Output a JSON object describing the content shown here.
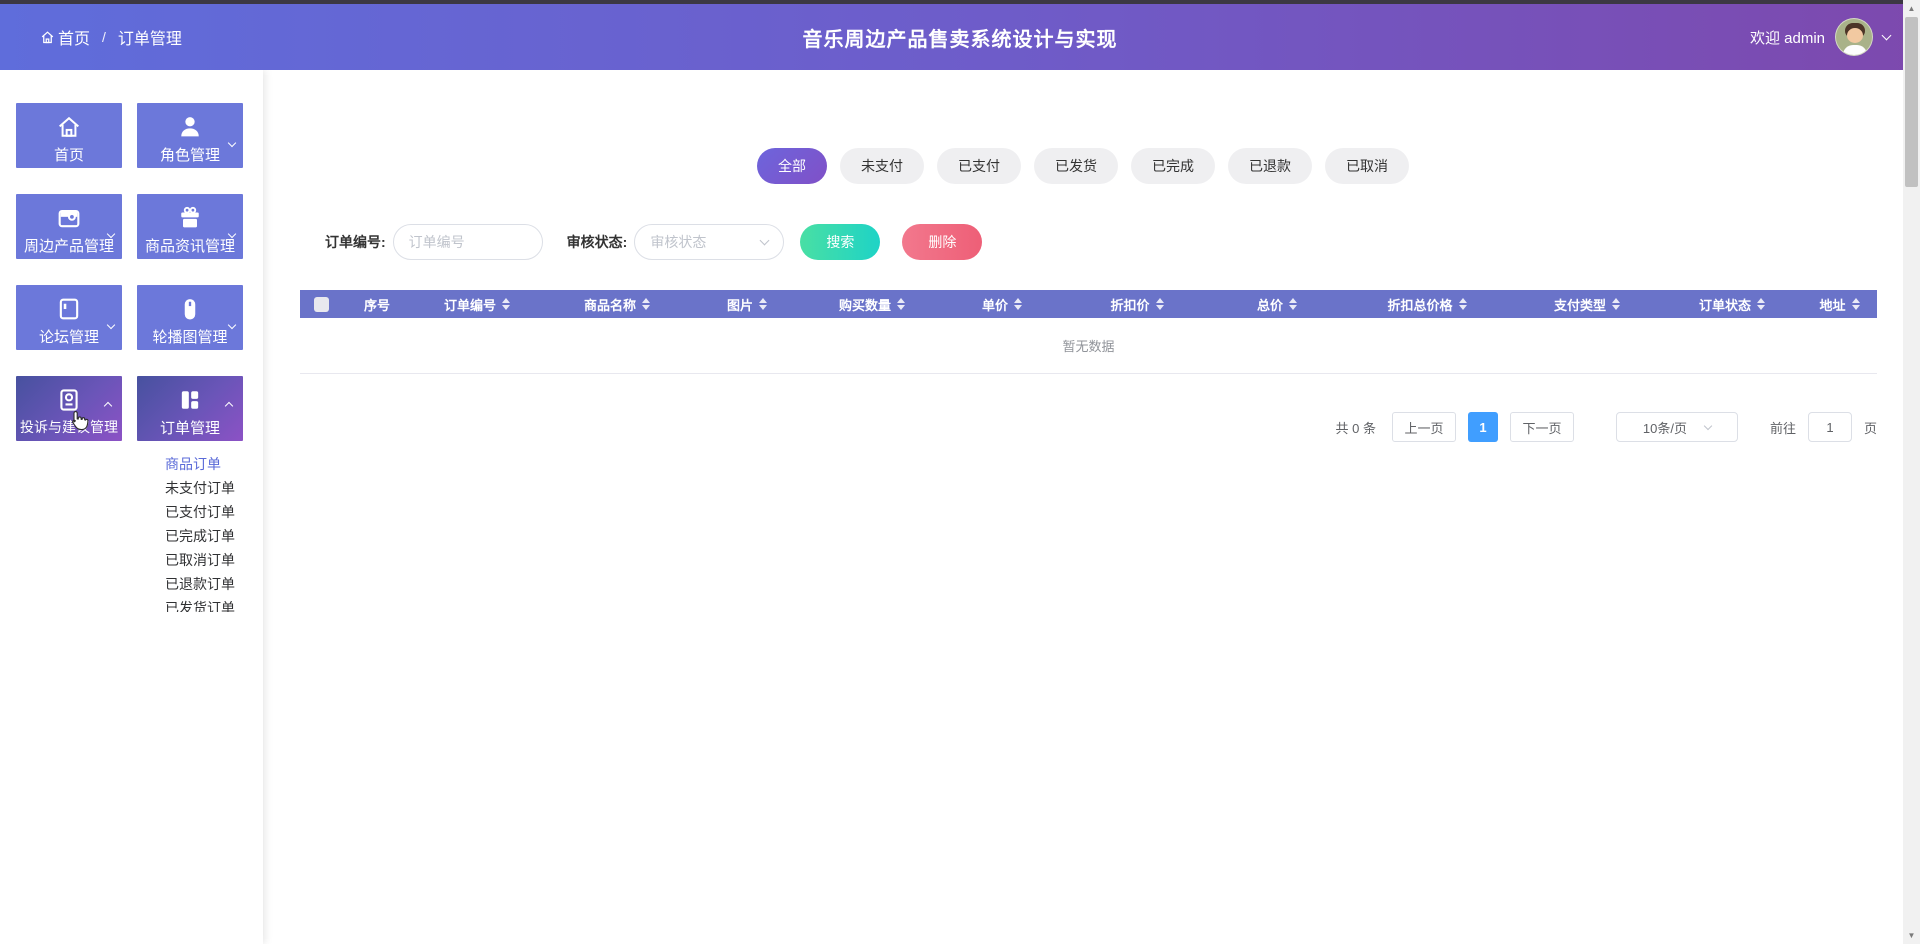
{
  "header": {
    "breadcrumb": {
      "home": "首页",
      "separator": "/",
      "current": "订单管理",
      "home_icon": "home-icon"
    },
    "title": "音乐周边产品售卖系统设计与实现",
    "welcome": "欢迎 admin",
    "avatar_icon": "user-avatar",
    "dropdown_icon": "chevron-down-icon"
  },
  "sidebar": {
    "tiles": [
      {
        "label": "首页",
        "icon": "home-icon",
        "variant": "flat",
        "chevron": false
      },
      {
        "label": "角色管理",
        "icon": "user-icon",
        "variant": "flat",
        "chevron": true
      },
      {
        "label": "周边产品管理",
        "icon": "product-box-icon",
        "variant": "flat",
        "chevron": true
      },
      {
        "label": "商品资讯管理",
        "icon": "gift-icon",
        "variant": "flat",
        "chevron": true
      },
      {
        "label": "论坛管理",
        "icon": "notebook-icon",
        "variant": "flat",
        "chevron": true
      },
      {
        "label": "轮播图管理",
        "icon": "mouse-icon",
        "variant": "flat",
        "chevron": true
      },
      {
        "label": "投诉与建议管理",
        "icon": "contact-badge-icon",
        "variant": "gradient",
        "chevron": true
      },
      {
        "label": "订单管理",
        "icon": "grid-icon",
        "variant": "gradient",
        "chevron": true
      }
    ],
    "submenu": [
      {
        "label": "商品订单",
        "active": true
      },
      {
        "label": "未支付订单",
        "active": false
      },
      {
        "label": "已支付订单",
        "active": false
      },
      {
        "label": "已完成订单",
        "active": false
      },
      {
        "label": "已取消订单",
        "active": false
      },
      {
        "label": "已退款订单",
        "active": false
      },
      {
        "label": "已发货订单",
        "active": false
      }
    ]
  },
  "filters": {
    "chips": [
      {
        "label": "全部",
        "active": true
      },
      {
        "label": "未支付",
        "active": false
      },
      {
        "label": "已支付",
        "active": false
      },
      {
        "label": "已发货",
        "active": false
      },
      {
        "label": "已完成",
        "active": false
      },
      {
        "label": "已退款",
        "active": false
      },
      {
        "label": "已取消",
        "active": false
      }
    ]
  },
  "search": {
    "order_label": "订单编号:",
    "order_placeholder": "订单编号",
    "order_value": "",
    "audit_label": "审核状态:",
    "audit_placeholder": "审核状态",
    "search_button": "搜索",
    "delete_button": "删除"
  },
  "table": {
    "columns": [
      {
        "label": "序号",
        "sortable": false
      },
      {
        "label": "订单编号",
        "sortable": true
      },
      {
        "label": "商品名称",
        "sortable": true
      },
      {
        "label": "图片",
        "sortable": true
      },
      {
        "label": "购买数量",
        "sortable": true
      },
      {
        "label": "单价",
        "sortable": true
      },
      {
        "label": "折扣价",
        "sortable": true
      },
      {
        "label": "总价",
        "sortable": true
      },
      {
        "label": "折扣总价格",
        "sortable": true
      },
      {
        "label": "支付类型",
        "sortable": true
      },
      {
        "label": "订单状态",
        "sortable": true
      },
      {
        "label": "地址",
        "sortable": true
      }
    ],
    "empty_text": "暂无数据"
  },
  "pagination": {
    "total": "共 0 条",
    "prev": "上一页",
    "current": "1",
    "next": "下一页",
    "page_size": "10条/页",
    "goto_label": "前往",
    "goto_value": "1",
    "unit": "页"
  },
  "colors": {
    "header_gradient": [
      "#5f6ddb",
      "#7d49ae"
    ],
    "tile_flat": "#6c78da",
    "tile_gradient": [
      "#47519f",
      "#8c52c5"
    ],
    "chip_active_gradient": [
      "#6d65dc",
      "#8050c7"
    ],
    "search_button_gradient": [
      "#49dfa4",
      "#1ed3c6"
    ],
    "delete_button": "#ee6479",
    "table_header_bg": "#6a73c9",
    "submenu_active": "#5a6ad8",
    "pagination_active": "#409eff"
  }
}
